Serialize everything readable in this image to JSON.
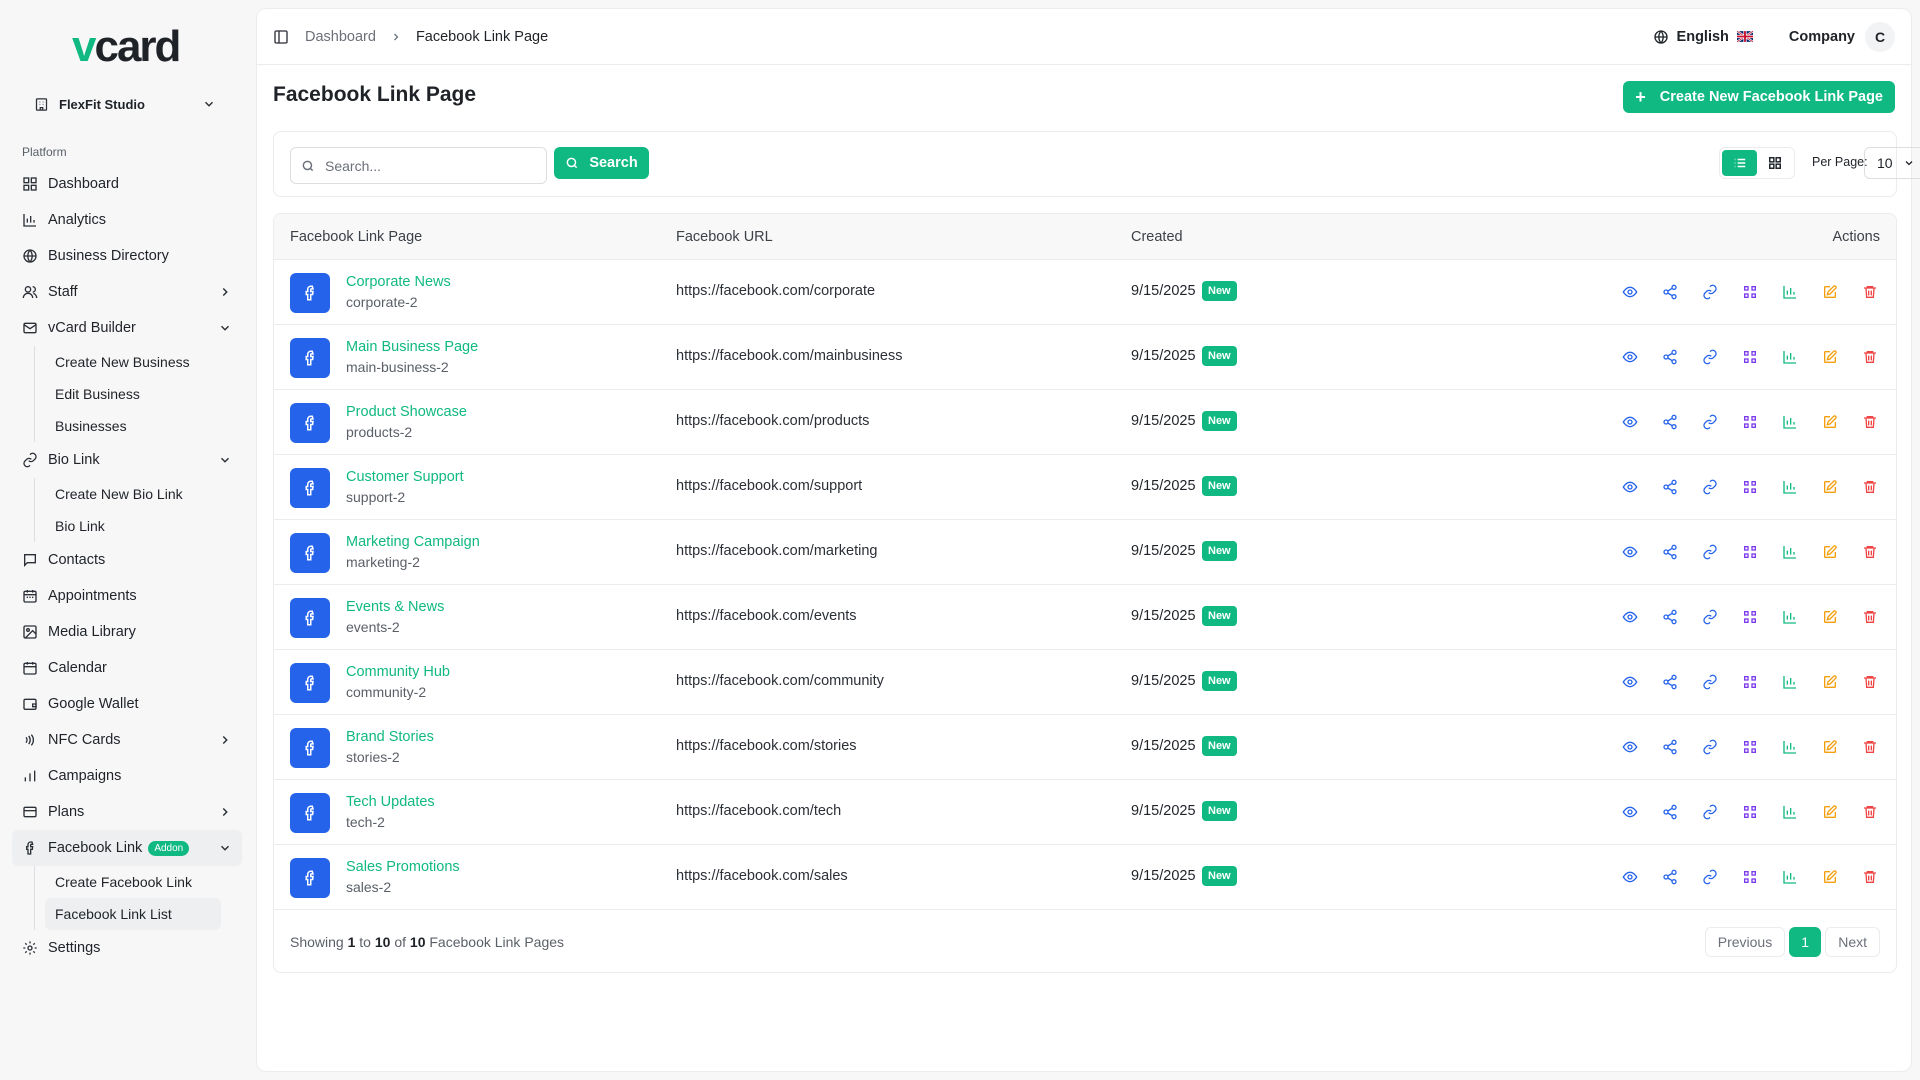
{
  "sidebar": {
    "logo": {
      "part1": "v",
      "part2": "card"
    },
    "team": "FlexFit Studio",
    "section_label": "Platform",
    "items": [
      {
        "label": "Dashboard",
        "icon": "grid-icon"
      },
      {
        "label": "Analytics",
        "icon": "chart-icon"
      },
      {
        "label": "Business Directory",
        "icon": "globe-icon"
      },
      {
        "label": "Staff",
        "icon": "users-icon"
      },
      {
        "label": "vCard Builder",
        "icon": "mail-icon"
      },
      {
        "label": "Create New Business"
      },
      {
        "label": "Edit Business"
      },
      {
        "label": "Businesses"
      },
      {
        "label": "Bio Link",
        "icon": "link-icon"
      },
      {
        "label": "Create New Bio Link"
      },
      {
        "label": "Bio Link"
      },
      {
        "label": "Contacts",
        "icon": "message-icon"
      },
      {
        "label": "Appointments",
        "icon": "calendar-icon"
      },
      {
        "label": "Media Library",
        "icon": "image-icon"
      },
      {
        "label": "Calendar",
        "icon": "calendar-icon"
      },
      {
        "label": "Google Wallet",
        "icon": "wallet-icon"
      },
      {
        "label": "NFC Cards",
        "icon": "nfc-icon"
      },
      {
        "label": "Campaigns",
        "icon": "bar-icon"
      },
      {
        "label": "Plans",
        "icon": "card-icon"
      },
      {
        "label": "Facebook Link",
        "icon": "facebook-icon",
        "badge": "Addon"
      },
      {
        "label": "Create Facebook Link"
      },
      {
        "label": "Facebook Link List"
      },
      {
        "label": "Settings",
        "icon": "gear-icon"
      }
    ]
  },
  "header": {
    "breadcrumb": [
      "Dashboard",
      "Facebook Link Page"
    ],
    "language": "English",
    "company": "Company",
    "avatar": "C"
  },
  "page": {
    "title": "Facebook Link Page",
    "create_label": "Create New Facebook Link Page",
    "search_placeholder": "Search...",
    "search_button": "Search",
    "per_page_label": "Per Page:",
    "per_page_value": "10"
  },
  "table": {
    "columns": [
      "Facebook Link Page",
      "Facebook URL",
      "Created",
      "Actions"
    ],
    "rows": [
      {
        "name": "Corporate News",
        "slug": "corporate-2",
        "url": "https://facebook.com/corporate",
        "date": "9/15/2025",
        "badge": "New"
      },
      {
        "name": "Main Business Page",
        "slug": "main-business-2",
        "url": "https://facebook.com/mainbusiness",
        "date": "9/15/2025",
        "badge": "New"
      },
      {
        "name": "Product Showcase",
        "slug": "products-2",
        "url": "https://facebook.com/products",
        "date": "9/15/2025",
        "badge": "New"
      },
      {
        "name": "Customer Support",
        "slug": "support-2",
        "url": "https://facebook.com/support",
        "date": "9/15/2025",
        "badge": "New"
      },
      {
        "name": "Marketing Campaign",
        "slug": "marketing-2",
        "url": "https://facebook.com/marketing",
        "date": "9/15/2025",
        "badge": "New"
      },
      {
        "name": "Events & News",
        "slug": "events-2",
        "url": "https://facebook.com/events",
        "date": "9/15/2025",
        "badge": "New"
      },
      {
        "name": "Community Hub",
        "slug": "community-2",
        "url": "https://facebook.com/community",
        "date": "9/15/2025",
        "badge": "New"
      },
      {
        "name": "Brand Stories",
        "slug": "stories-2",
        "url": "https://facebook.com/stories",
        "date": "9/15/2025",
        "badge": "New"
      },
      {
        "name": "Tech Updates",
        "slug": "tech-2",
        "url": "https://facebook.com/tech",
        "date": "9/15/2025",
        "badge": "New"
      },
      {
        "name": "Sales Promotions",
        "slug": "sales-2",
        "url": "https://facebook.com/sales",
        "date": "9/15/2025",
        "badge": "New"
      }
    ],
    "actions": [
      {
        "icon": "eye-icon",
        "color": "#2563eb"
      },
      {
        "icon": "share-icon",
        "color": "#2563eb"
      },
      {
        "icon": "link-icon",
        "color": "#2563eb"
      },
      {
        "icon": "qr-icon",
        "color": "#7c3aed"
      },
      {
        "icon": "chart-icon",
        "color": "#10b981"
      },
      {
        "icon": "edit-icon",
        "color": "#f59e0b"
      },
      {
        "icon": "trash-icon",
        "color": "#ef4444"
      }
    ]
  },
  "footer": {
    "showing_prefix": "Showing",
    "from": "1",
    "to_word": "to",
    "to": "10",
    "of_word": "of",
    "total": "10",
    "suffix": "Facebook Link Pages",
    "prev": "Previous",
    "page": "1",
    "next": "Next"
  },
  "colors": {
    "accent": "#10b981",
    "facebook": "#2563eb"
  }
}
